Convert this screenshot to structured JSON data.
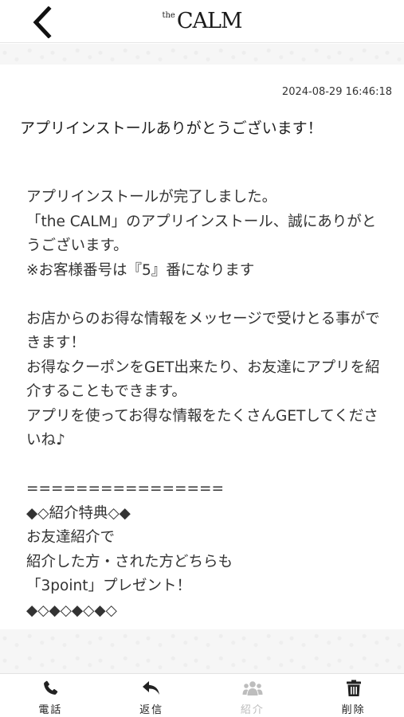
{
  "header": {
    "logo_small": "the",
    "logo_main": "CALM"
  },
  "message": {
    "timestamp": "2024-08-29 16:46:18",
    "subject": "アプリインストールありがとうございます！",
    "body": "アプリインストールが完了しました。\n「the CALM」のアプリインストール、誠にありがとうございます。\n※お客様番号は『5』番になります\n\nお店からのお得な情報をメッセージで受けとる事ができます！\nお得なクーポンをGET出来たり、お友達にアプリを紹介することもできます。\nアプリを使ってお得な情報をたくさんGETしてくださいね♪\n\n================\n◆◇紹介特典◇◆\nお友達紹介で\n紹介した方・された方どちらも\n「3point」プレゼント！\n◆◇◆◇◆◇◆◇"
  },
  "tabbar": {
    "items": [
      {
        "label": "電話",
        "icon": "phone-icon",
        "enabled": true
      },
      {
        "label": "返信",
        "icon": "reply-icon",
        "enabled": true
      },
      {
        "label": "紹介",
        "icon": "users-icon",
        "enabled": false
      },
      {
        "label": "削除",
        "icon": "trash-icon",
        "enabled": true
      }
    ]
  },
  "colors": {
    "text": "#333333",
    "disabled": "#bdbdbd",
    "divider": "#e3e3e3"
  }
}
